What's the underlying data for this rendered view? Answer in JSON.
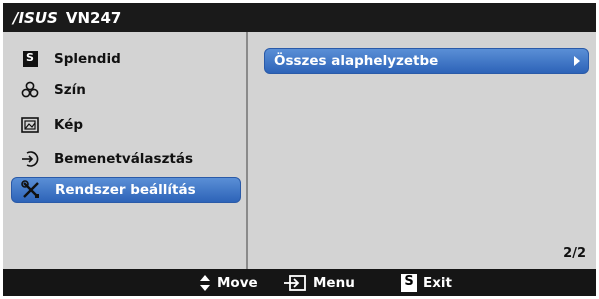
{
  "header": {
    "brand": "/ISUS",
    "model": "VN247"
  },
  "menu": {
    "items": [
      {
        "label": "Splendid",
        "icon": "splendid-s-icon"
      },
      {
        "label": "Szín",
        "icon": "color-circles-icon"
      },
      {
        "label": "Kép",
        "icon": "picture-icon"
      },
      {
        "label": "Bemenetválasztás",
        "icon": "input-select-icon"
      },
      {
        "label": "Rendszer beállítás",
        "icon": "wrench-screwdriver-icon",
        "selected": true
      }
    ]
  },
  "submenu": {
    "option": "Összes alaphelyzetbe",
    "page": "2/2"
  },
  "footer": {
    "move_label": "Move",
    "menu_label": "Menu",
    "exit_label": "Exit",
    "exit_key": "S"
  },
  "colors": {
    "selection": "#3a70c4",
    "panel": "#d3d3d3",
    "bar": "#151515"
  }
}
